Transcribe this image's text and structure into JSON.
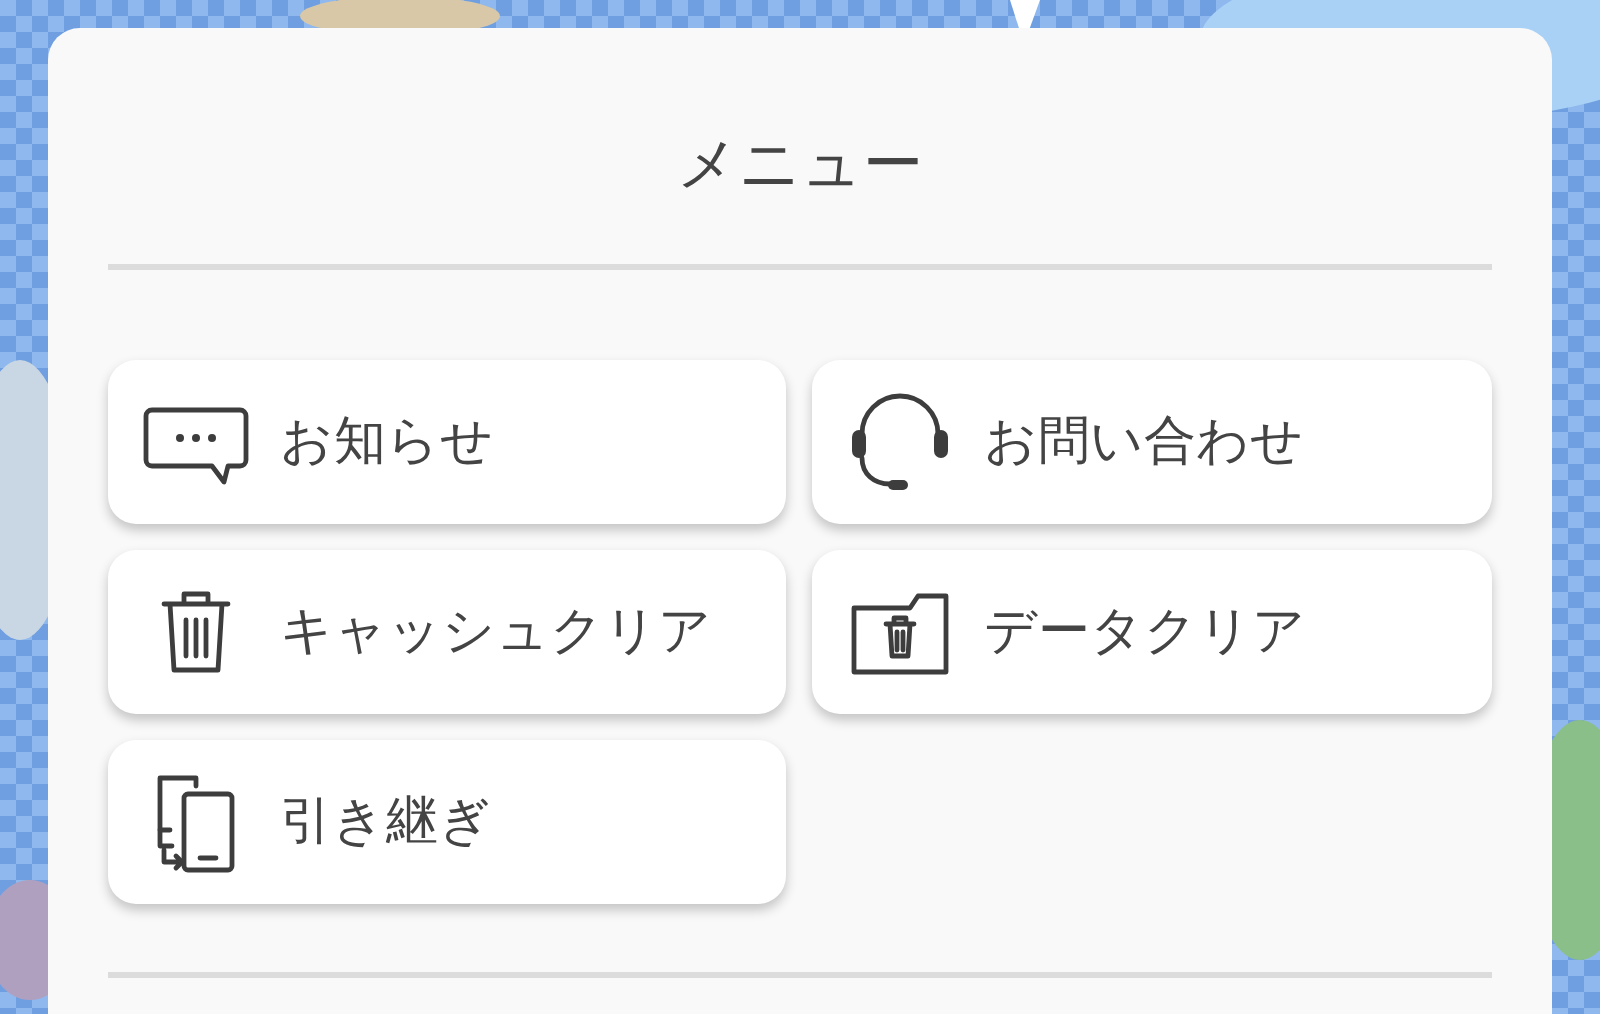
{
  "title": "メニュー",
  "menu_items": [
    {
      "label": "お知らせ",
      "kind": "notice"
    },
    {
      "label": "お問い合わせ",
      "kind": "contact"
    },
    {
      "label": "キャッシュクリア",
      "kind": "cache"
    },
    {
      "label": "データクリア",
      "kind": "data"
    },
    {
      "label": "引き継ぎ",
      "kind": "transfer"
    }
  ]
}
